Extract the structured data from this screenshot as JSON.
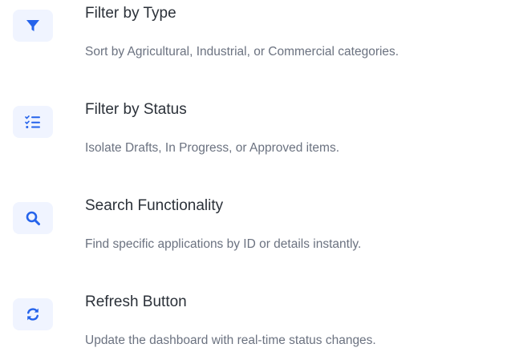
{
  "accent_color": "#2563eb",
  "features": [
    {
      "icon": "filter-icon",
      "title": "Filter by Type",
      "description": "Sort by Agricultural, Industrial, or Commercial categories."
    },
    {
      "icon": "checklist-icon",
      "title": "Filter by Status",
      "description": "Isolate Drafts, In Progress, or Approved items."
    },
    {
      "icon": "search-icon",
      "title": "Search Functionality",
      "description": "Find specific applications by ID or details instantly."
    },
    {
      "icon": "refresh-icon",
      "title": "Refresh Button",
      "description": "Update the dashboard with real-time status changes."
    }
  ]
}
